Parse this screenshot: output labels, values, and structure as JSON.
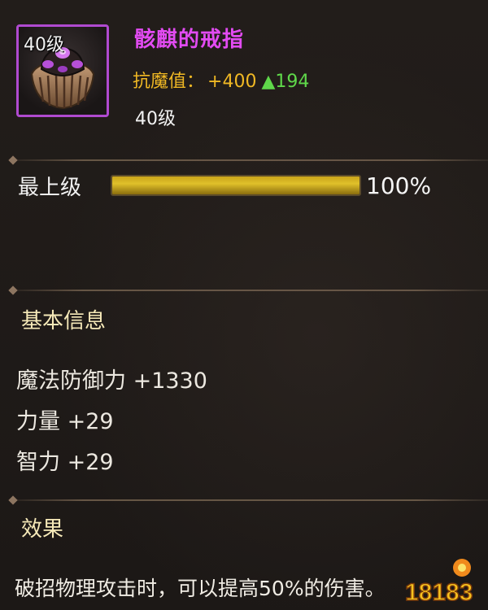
{
  "item": {
    "level_badge": "40级",
    "name": "骸麒的戒指",
    "stat_label": "抗魔值：",
    "stat_value": "+400",
    "stat_increase": "▲194",
    "level_requirement": "40级"
  },
  "progress": {
    "label": "最上级",
    "percent_text": "100%",
    "fraction": 1.0
  },
  "basic_info": {
    "title": "基本信息",
    "attributes": [
      "魔法防御力 +1330",
      "力量 +29",
      "智力 +29"
    ]
  },
  "effect": {
    "title": "效果",
    "text": "破招物理攻击时，可以提高50%的伤害。"
  },
  "watermark": {
    "text": "18183"
  },
  "colors": {
    "item_name": "#e24bf2",
    "stat": "#f0b824",
    "increase": "#5fd84a",
    "frame": "#b04ad0",
    "progress_fill": "#d4b01f"
  }
}
